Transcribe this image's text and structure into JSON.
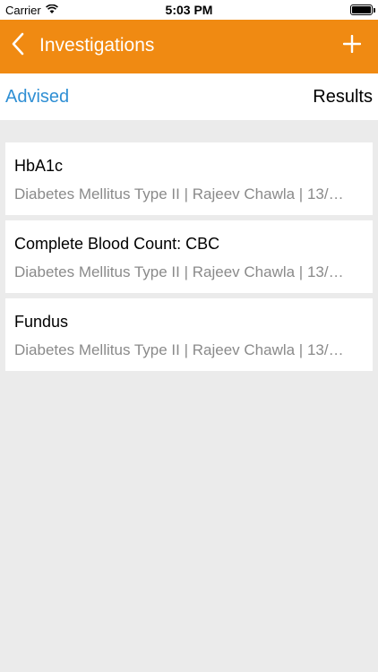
{
  "status_bar": {
    "carrier": "Carrier",
    "time": "5:03 PM"
  },
  "nav": {
    "title": "Investigations",
    "back_icon": "chevron-left-icon",
    "add_icon": "plus-icon",
    "color": "#f08a12"
  },
  "tabs": {
    "advised": "Advised",
    "results": "Results",
    "active_color": "#2f8fd4"
  },
  "investigations": [
    {
      "title": "HbA1c",
      "subtitle": "Diabetes Mellitus Type II | Rajeev Chawla | 13/…"
    },
    {
      "title": "Complete Blood Count: CBC",
      "subtitle": "Diabetes Mellitus Type II | Rajeev Chawla | 13/…"
    },
    {
      "title": "Fundus",
      "subtitle": "Diabetes Mellitus Type II | Rajeev Chawla | 13/…"
    }
  ]
}
